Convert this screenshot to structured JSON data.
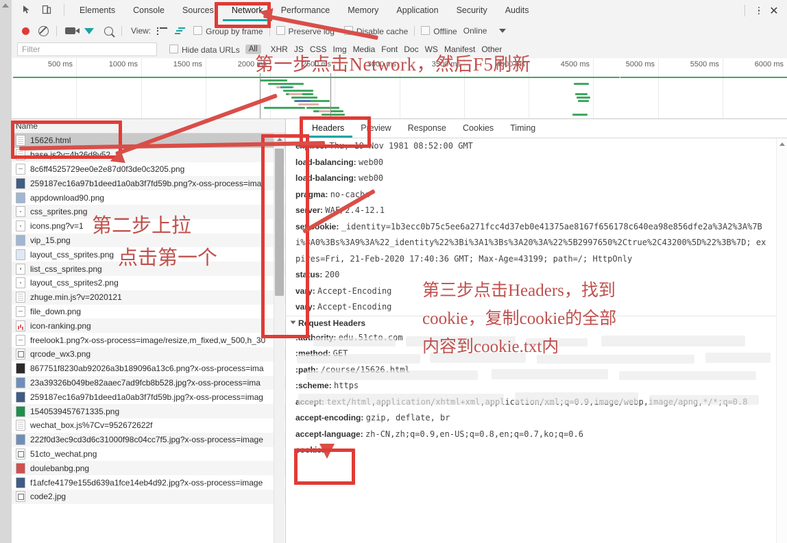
{
  "window": {
    "devtools_tabs": [
      "Elements",
      "Console",
      "Sources",
      "Network",
      "Performance",
      "Memory",
      "Application",
      "Security",
      "Audits"
    ],
    "active_tab": "Network",
    "kebab_title": "More tools",
    "close_title": "Close DevTools"
  },
  "toolbar": {
    "record_title": "record",
    "clear_title": "clear",
    "camera_title": "capture screenshots",
    "filter_title": "filter",
    "search_title": "search",
    "view_label": "View:",
    "group_by_frame": "Group by frame",
    "preserve_log": "Preserve log",
    "disable_cache": "Disable cache",
    "offline": "Offline",
    "online": "Online"
  },
  "filterbar": {
    "placeholder": "Filter",
    "hide_data_urls": "Hide data URLs",
    "all": "All",
    "types": [
      "XHR",
      "JS",
      "CSS",
      "Img",
      "Media",
      "Font",
      "Doc",
      "WS",
      "Manifest",
      "Other"
    ]
  },
  "overview": {
    "ticks": [
      "500 ms",
      "1000 ms",
      "1500 ms",
      "2000 ms",
      "2500 ms",
      "3000 ms",
      "3500 ms",
      "4000 ms",
      "4500 ms",
      "5000 ms",
      "5500 ms",
      "6000 ms"
    ]
  },
  "requests": {
    "column_header": "Name",
    "items": [
      {
        "name": "15626.html",
        "icon": "doc",
        "selected": true
      },
      {
        "name": "base.js?v=4h26d8v52",
        "icon": "doc",
        "selected": false
      },
      {
        "name": "8c6ff4525729ee0e2e87d0f3de0c3205.png",
        "icon": "dash",
        "selected": false
      },
      {
        "name": "259187ec16a97b1deed1a0ab3f7fd59b.png?x-oss-process=ima",
        "icon": "img3",
        "selected": false
      },
      {
        "name": "appdownload90.png",
        "icon": "img2",
        "selected": false
      },
      {
        "name": "css_sprites.png",
        "icon": "dot",
        "selected": false
      },
      {
        "name": "icons.png?v=1",
        "icon": "dot",
        "selected": false
      },
      {
        "name": "vip_15.png",
        "icon": "img2",
        "selected": false
      },
      {
        "name": "layout_css_sprites.png",
        "icon": "img",
        "selected": false
      },
      {
        "name": "list_css_sprites.png",
        "icon": "dot",
        "selected": false
      },
      {
        "name": "layout_css_sprites2.png",
        "icon": "dot",
        "selected": false
      },
      {
        "name": "zhuge.min.js?v=2020121",
        "icon": "doc",
        "selected": false
      },
      {
        "name": "file_down.png",
        "icon": "dash",
        "selected": false
      },
      {
        "name": "icon-ranking.png",
        "icon": "chart",
        "selected": false
      },
      {
        "name": "freelook1.png?x-oss-process=image/resize,m_fixed,w_500,h_30",
        "icon": "dash",
        "selected": false
      },
      {
        "name": "qrcode_wx3.png",
        "icon": "qr",
        "selected": false
      },
      {
        "name": "867751f8230ab92026a3b189096a13c6.png?x-oss-process=ima",
        "icon": "dk",
        "selected": false
      },
      {
        "name": "23a39326b049be82aaec7ad9fcb8b528.jpg?x-oss-process=ima",
        "icon": "img4",
        "selected": false
      },
      {
        "name": "259187ec16a97b1deed1a0ab3f7fd59b.jpg?x-oss-process=imag",
        "icon": "img3",
        "selected": false
      },
      {
        "name": "1540539457671335.png",
        "icon": "green",
        "selected": false
      },
      {
        "name": "wechat_box.js%7Cv=952672622f",
        "icon": "doc",
        "selected": false
      },
      {
        "name": "222f0d3ec9cd3d6c31000f98c04cc7f5.jpg?x-oss-process=image",
        "icon": "img4",
        "selected": false
      },
      {
        "name": "51cto_wechat.png",
        "icon": "qr",
        "selected": false
      },
      {
        "name": "doulebanbg.png",
        "icon": "red",
        "selected": false
      },
      {
        "name": "f1afcfe4179e155d639a1fce14eb4d92.jpg?x-oss-process=image",
        "icon": "img3",
        "selected": false
      },
      {
        "name": "code2.jpg",
        "icon": "qr",
        "selected": false
      }
    ]
  },
  "detail": {
    "tabs": [
      "Headers",
      "Preview",
      "Response",
      "Cookies",
      "Timing"
    ],
    "active_tab": "Headers",
    "response_headers": [
      {
        "key": "expires:",
        "value": "Thu, 19 Nov 1981 08:52:00 GMT"
      },
      {
        "key": "load-balancing:",
        "value": "web00"
      },
      {
        "key": "load-balancing:",
        "value": "web00"
      },
      {
        "key": "pragma:",
        "value": "no-cache"
      },
      {
        "key": "server:",
        "value": "WAF/2.4-12.1"
      },
      {
        "key": "set-cookie:",
        "value": "_identity=1b3ecc0b75c5ee6a271fcc4d37eb0e41375ae8167f656178c640ea98e856dfe2a%3A2%3A%7B"
      },
      {
        "key": "",
        "value": "i%3A0%3Bs%3A9%3A%22_identity%22%3Bi%3A1%3Bs%3A20%3A%22%5B2997650%2Ctrue%2C43200%5D%22%3B%7D; ex"
      },
      {
        "key": "",
        "value": "pires=Fri, 21-Feb-2020 17:40:36 GMT; Max-Age=43199; path=/; HttpOnly"
      },
      {
        "key": "status:",
        "value": "200"
      },
      {
        "key": "vary:",
        "value": "Accept-Encoding"
      },
      {
        "key": "vary:",
        "value": "Accept-Encoding"
      }
    ],
    "request_headers_title": "Request Headers",
    "request_headers": [
      {
        "key": ":authority:",
        "value": "edu.51cto.com"
      },
      {
        "key": ":method:",
        "value": "GET"
      },
      {
        "key": ":path:",
        "value": "/course/15626.html"
      },
      {
        "key": ":scheme:",
        "value": "https"
      },
      {
        "key": "accept:",
        "value": "text/html,application/xhtml+xml,application/xml;q=0.9,image/webp,image/apng,*/*;q=0.8"
      },
      {
        "key": "accept-encoding:",
        "value": "gzip, deflate, br"
      },
      {
        "key": "accept-language:",
        "value": "zh-CN,zh;q=0.9,en-US;q=0.8,en;q=0.7,ko;q=0.6"
      },
      {
        "key": "cookie:",
        "value": ""
      }
    ]
  },
  "annotations": {
    "step1": "第一步点击Network，然后F5刷新",
    "step2_line1": "第二步上拉",
    "step2_line2": "点击第一个",
    "step3_line1": "第三步点击Headers，找到",
    "step3_line2": "cookie，复制cookie的全部",
    "step3_line3": "内容到cookie.txt内"
  },
  "colors": {
    "annotation_red": "#c0504d",
    "box_red": "#e03b36",
    "accent_teal": "#19a5a5",
    "waterfall_green": "#41a85f"
  }
}
